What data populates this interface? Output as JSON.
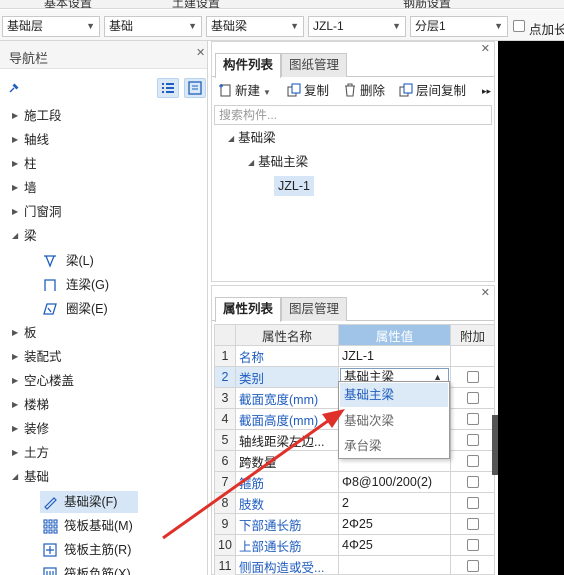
{
  "menu": {
    "items": [
      "基本设置",
      "土建设置",
      "钢筋设置"
    ]
  },
  "filters": {
    "floor_type": "基础层",
    "category": "基础",
    "component_type": "基础梁",
    "component": "JZL-1",
    "layer": "分层1",
    "extend_label": "点加长"
  },
  "nav": {
    "title": "导航栏",
    "groups": [
      {
        "label": "施工段",
        "expanded": false
      },
      {
        "label": "轴线",
        "expanded": false
      },
      {
        "label": "柱",
        "expanded": false
      },
      {
        "label": "墙",
        "expanded": false
      },
      {
        "label": "门窗洞",
        "expanded": false
      },
      {
        "label": "梁",
        "expanded": true
      },
      {
        "label": "板",
        "expanded": false
      },
      {
        "label": "装配式",
        "expanded": false
      },
      {
        "label": "空心楼盖",
        "expanded": false
      },
      {
        "label": "楼梯",
        "expanded": false
      },
      {
        "label": "装修",
        "expanded": false
      },
      {
        "label": "土方",
        "expanded": false
      },
      {
        "label": "基础",
        "expanded": true
      }
    ],
    "beam_children": [
      "梁(L)",
      "连梁(G)",
      "圈梁(E)"
    ],
    "foundation_children": [
      "基础梁(F)",
      "筏板基础(M)",
      "筏板主筋(R)",
      "筏板负筋(X)"
    ],
    "selected": "基础梁(F)"
  },
  "component_list": {
    "tabs": [
      "构件列表",
      "图纸管理"
    ],
    "active_tab": "构件列表",
    "toolbar": {
      "new": "新建",
      "copy": "复制",
      "delete": "删除",
      "floor_copy": "层间复制"
    },
    "search_placeholder": "搜索构件...",
    "tree": {
      "root": "基础梁",
      "child": "基础主梁",
      "leaf": "JZL-1"
    }
  },
  "properties": {
    "tabs": [
      "属性列表",
      "图层管理"
    ],
    "active_tab": "属性列表",
    "headers": {
      "name": "属性名称",
      "value": "属性值",
      "extra": "附加"
    },
    "rows": [
      {
        "no": "1",
        "name": "名称",
        "value": "JZL-1"
      },
      {
        "no": "2",
        "name": "类别",
        "value": "基础主梁"
      },
      {
        "no": "3",
        "name": "截面宽度(mm)",
        "value": ""
      },
      {
        "no": "4",
        "name": "截面高度(mm)",
        "value": ""
      },
      {
        "no": "5",
        "name": "轴线距梁左边...",
        "value": ""
      },
      {
        "no": "6",
        "name": "跨数量",
        "value": ""
      },
      {
        "no": "7",
        "name": "箍筋",
        "value": "Φ8@100/200(2)"
      },
      {
        "no": "8",
        "name": "肢数",
        "value": "2"
      },
      {
        "no": "9",
        "name": "下部通长筋",
        "value": "2Φ25"
      },
      {
        "no": "10",
        "name": "上部通长筋",
        "value": "4Φ25"
      },
      {
        "no": "11",
        "name": "侧面构造或受...",
        "value": ""
      }
    ]
  },
  "dropdown": {
    "options": [
      "基础主梁",
      "基础次梁",
      "承台梁"
    ],
    "highlighted": "基础主梁"
  },
  "colors": {
    "accent_blue": "#1f5dbf",
    "selection": "#d6e6f7",
    "header_value": "#9fc4e8",
    "arrow_red": "#e0302a"
  }
}
